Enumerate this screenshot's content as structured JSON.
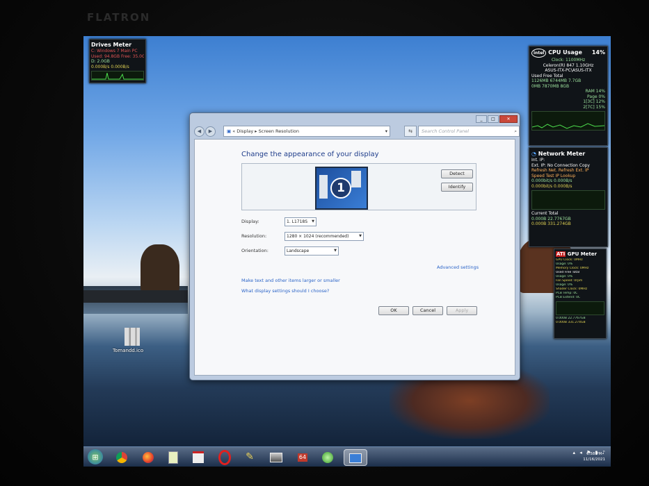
{
  "monitor": {
    "brand": "FLATRON"
  },
  "gadgets": {
    "drives": {
      "title": "Drives Meter",
      "lines": [
        "C: Windows 7 Main PC",
        "Used: 94.8GB  Free: 35.0GB",
        "D: 2.0GB",
        "0.000B/s  0.000B/s"
      ]
    },
    "cpu": {
      "title": "CPU Usage",
      "percent": "14%",
      "lines": [
        "Clock: 1100MHz",
        "Celeron(R) 847 1.10GHz",
        "ASUS-ITX-PC\\ASUS-ITX",
        "Used    Free    Total",
        "1126MB  6744MB  7.7GB",
        "0MB     7870MB  8GB",
        "RAM     14%",
        "Page    0%",
        "1[3C]  12%",
        "2[7C]  15%"
      ]
    },
    "network": {
      "title": "Network Meter",
      "lines": [
        "Int. IP:",
        "Ext. IP: No Connection  Copy",
        "Refresh Net.  Refresh Ext. IP",
        "Speed Test  IP Lookup",
        "0.000bit/s  0.000B/s",
        "0.000bit/s  0.000B/s",
        "Current       Total",
        "0.000B   22.7767GB",
        "0.000B   331.274GB"
      ]
    },
    "gpu": {
      "title": "GPU Meter",
      "lines": [
        "GPU Clock: 0MHz",
        "Usage: 0%",
        "Memory Clock: 0MHz",
        "Used  Free  Total",
        "Usage: 0%",
        "Fan Speed: 0rpm",
        "Usage: 0%",
        "Shader Clock: 0MHz",
        "PCB Temp: 0C",
        "PCB Extend: 0C",
        "0.000B  22.7767GB",
        "0.000B  331.274GB"
      ]
    }
  },
  "desktop_icon": {
    "label": "Tomandd.ico"
  },
  "window": {
    "breadcrumb": [
      "Display",
      "Screen Resolution"
    ],
    "search_placeholder": "Search Control Panel",
    "heading": "Change the appearance of your display",
    "monitor_number": "1",
    "detect_label": "Detect",
    "identify_label": "Identify",
    "display_label": "Display:",
    "display_value": "1. L1718S",
    "resolution_label": "Resolution:",
    "resolution_value": "1280 × 1024 (recommended)",
    "orientation_label": "Orientation:",
    "orientation_value": "Landscape",
    "advanced_link": "Advanced settings",
    "link1": "Make text and other items larger or smaller",
    "link2": "What display settings should I choose?",
    "ok_label": "OK",
    "cancel_label": "Cancel",
    "apply_label": "Apply"
  },
  "taskbar": {
    "time": "6:58 PM",
    "date": "11/16/2021",
    "badge": "64"
  }
}
